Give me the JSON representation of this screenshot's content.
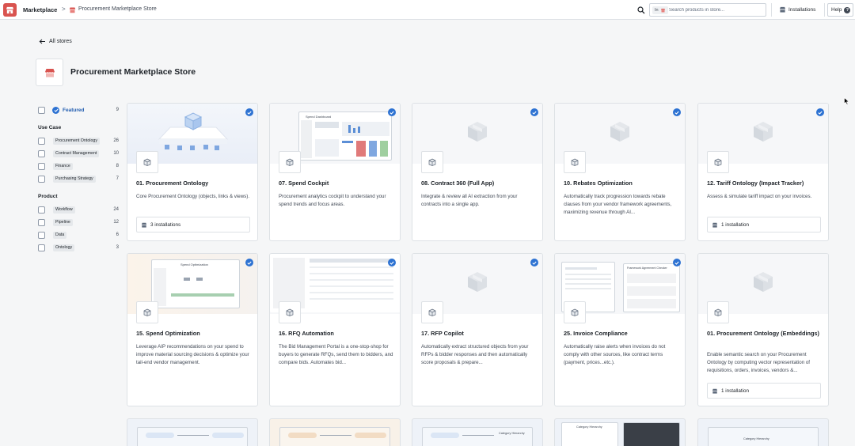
{
  "topbar": {
    "breadcrumb_root": "Marketplace",
    "breadcrumb_separator": ">",
    "breadcrumb_store": "Procurement Marketplace Store",
    "search_scope": "In",
    "search_placeholder": "Search products in store...",
    "installations_label": "Installations",
    "help_label": "Help",
    "help_glyph": "?"
  },
  "header": {
    "back_label": "All stores",
    "store_title": "Procurement Marketplace Store"
  },
  "filters": {
    "featured": {
      "label": "Featured",
      "count": "9"
    },
    "use_case": {
      "title": "Use Case",
      "items": [
        {
          "label": "Procurement Ontology",
          "count": "26"
        },
        {
          "label": "Contract Management",
          "count": "10"
        },
        {
          "label": "Finance",
          "count": "8"
        },
        {
          "label": "Purchasing Strategy",
          "count": "7"
        }
      ]
    },
    "product": {
      "title": "Product",
      "items": [
        {
          "label": "Workflow",
          "count": "24"
        },
        {
          "label": "Pipeline",
          "count": "12"
        },
        {
          "label": "Data",
          "count": "6"
        },
        {
          "label": "Ontology",
          "count": "3"
        }
      ]
    }
  },
  "cards": [
    {
      "title": "01. Procurement Ontology",
      "description": "Core Procurement Ontology (objects, links & views).",
      "installs": "3 installations"
    },
    {
      "title": "07. Spend Cockpit",
      "description": "Procurement analytics cockpit to understand your spend trends and focus areas.",
      "installs": ""
    },
    {
      "title": "08. Contract 360 (Full App)",
      "description": "Integrate & review all AI extraction from your contracts into a single app.",
      "installs": ""
    },
    {
      "title": "10. Rebates Optimization",
      "description": "Automatically track progression towards rebate clauses from your vendor framework agreements, maximizing revenue through AI...",
      "installs": ""
    },
    {
      "title": "12. Tariff Ontology (Impact Tracker)",
      "description": "Assess & simulate tariff impact on your invoices.",
      "installs": "1 installation"
    },
    {
      "title": "15. Spend Optimization",
      "description": "Leverage AIP recommendations on your spend to improve material sourcing decisions & optimize your tail-end vendor management.",
      "installs": ""
    },
    {
      "title": "16. RFQ Automation",
      "description": "The Bid Management Portal is a one-stop-shop for buyers to generate RFQs, send them to bidders, and compare bids. Automates bid...",
      "installs": ""
    },
    {
      "title": "17. RFP Copilot",
      "description": "Automatically extract structured objects from your RFPs & bidder responses and then automatically score proposals & prepare...",
      "installs": ""
    },
    {
      "title": "25. Invoice Compliance",
      "description": "Automatically raise alerts when invoices do not comply with other sources, like contract terms (payment, prices...etc.).",
      "installs": ""
    },
    {
      "title": "01. Procurement Ontology (Embeddings)",
      "description": "Enable semantic search on your Procurement Ontology by computing vector representation of requisitions, orders, invoices, vendors &...",
      "installs": "1 installation"
    }
  ],
  "hero_text": {
    "spend_dashboard": "Spend Dashboard",
    "spend_optimization": "Spend Optimization",
    "framework_checker": "Framework Agreement Checker",
    "category_hierarchy": "Category Hierarchy"
  },
  "colors": {
    "accent": "#2d72d2",
    "brand": "#d9534f"
  }
}
